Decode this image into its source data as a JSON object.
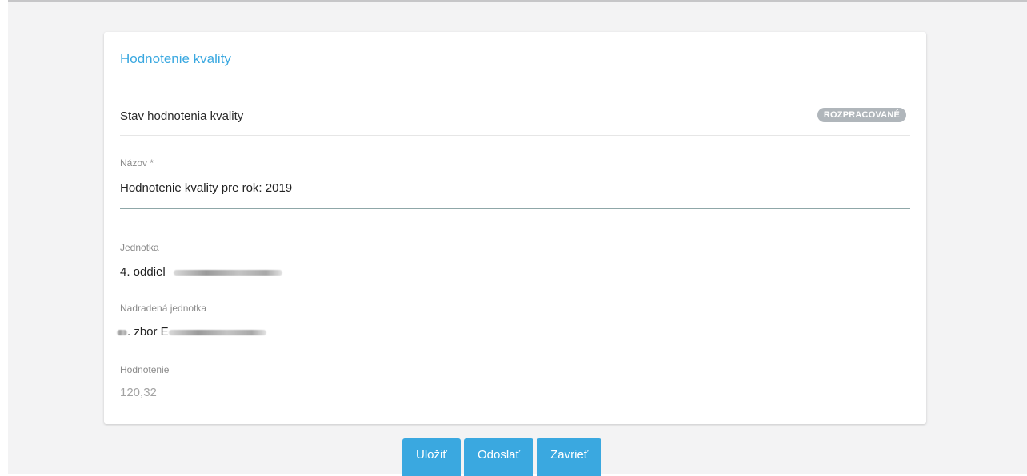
{
  "card": {
    "title": "Hodnotenie kvality",
    "status_label": "Stav hodnotenia kvality",
    "status_badge": "ROZPRACOVANÉ"
  },
  "fields": {
    "name_label": "Názov *",
    "name_value": "Hodnotenie kvality pre rok: 2019",
    "unit_label": "Jednotka",
    "unit_value": "4. oddiel",
    "parent_unit_label": "Nadradená jednotka",
    "parent_unit_value": ". zbor E",
    "rating_label": "Hodnotenie",
    "rating_value": "120,32"
  },
  "actions": {
    "save_label": "Uložiť",
    "send_label": "Odoslať",
    "close_label": "Zavrieť"
  },
  "colors": {
    "accent": "#3aa8e0",
    "badge_bg": "#b0b6bb",
    "page_bg": "#f3f3f4"
  }
}
